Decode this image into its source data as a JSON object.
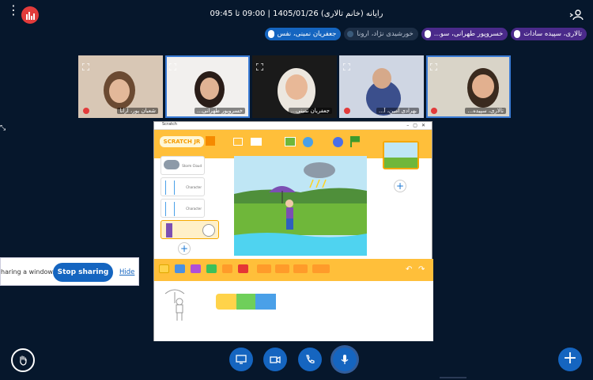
{
  "header": {
    "title": "رایانه (خانم تالاری) 1405/01/26 | 09:00 تا 09:45",
    "options_icon": "more-vertical-icon",
    "recording_icon": "recording-bars-icon",
    "user_icon": "user-list-icon"
  },
  "participants_bar": [
    {
      "name": "تالاری، سپیده سادات",
      "style": "purple"
    },
    {
      "name": "خسروپور طهرانی، سو...",
      "style": "purple"
    },
    {
      "name": "خورشیدی نژاد، ارونا",
      "style": "grey"
    },
    {
      "name": "جعفریان نمینی، نفس",
      "style": "blue"
    }
  ],
  "video_tiles": [
    {
      "name": "شعبان پور، ارانا",
      "muted": true,
      "active": false,
      "bg": "#d8c7b5"
    },
    {
      "name": "خسروپور طهرانی...",
      "muted": false,
      "active": true,
      "bg": "#f2f0ee"
    },
    {
      "name": "جعفریان نمینی...",
      "muted": false,
      "active": false,
      "bg": "#e6d9c3"
    },
    {
      "name": "بهرادی امین، آ...",
      "muted": true,
      "active": false,
      "bg": "#cfd6e3"
    },
    {
      "name": "تالاری، سپیده...",
      "muted": true,
      "active": true,
      "bg": "#d9d4c8"
    }
  ],
  "shared_window": {
    "title": "Scratch",
    "logo": "SCRATCH JR",
    "cards": [
      "Storm Cloud",
      "Character",
      "Character",
      ""
    ],
    "colors": {
      "bar": "#ffbf3a",
      "stage_sky": "#bfe6f5",
      "grass": "#6fb73a",
      "water": "#4fd3f0"
    }
  },
  "share_popup": {
    "text": "haring a window.",
    "stop_label": "Stop sharing",
    "hide_label": "Hide"
  },
  "controls": {
    "raise_hand_icon": "raise-hand-icon",
    "screen_icon": "screen-share-icon",
    "camera_icon": "video-camera-icon",
    "phone_icon": "phone-icon",
    "mic_icon": "microphone-icon",
    "plus_label": "+"
  }
}
